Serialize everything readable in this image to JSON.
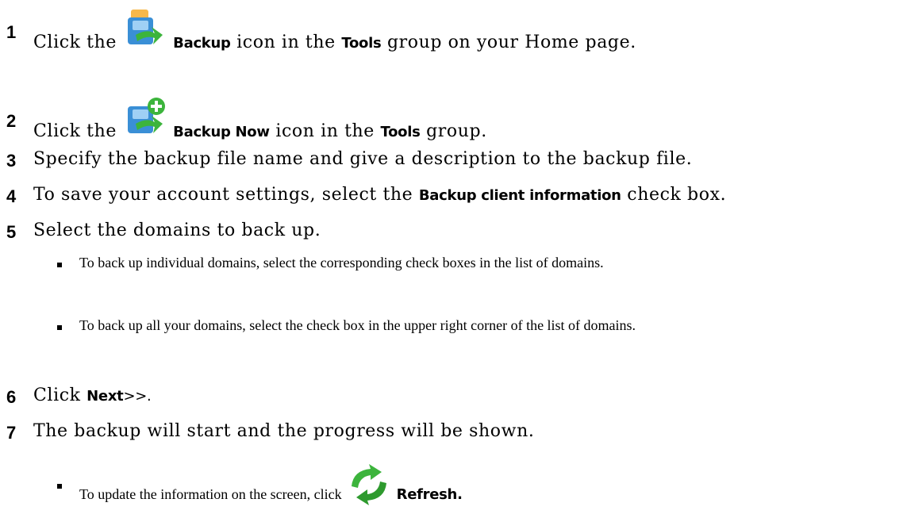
{
  "steps": [
    {
      "num": "1",
      "pre": "Click the",
      "ui1": "Backup",
      "mid": "icon in the",
      "ui2": "Tools",
      "post": "group on your Home page.",
      "icon": "backup-icon"
    },
    {
      "num": "2",
      "pre": "Click the",
      "ui1": "Backup Now",
      "mid": "icon in the",
      "ui2": "Tools",
      "post": "group.",
      "icon": "backup-now-icon"
    },
    {
      "num": "3",
      "text": "Specify the backup file name and give a description to the backup file."
    },
    {
      "num": "4",
      "pre": "To save your account settings, select the",
      "ui1": "Backup client information",
      "post": "check box."
    },
    {
      "num": "5",
      "text": "Select the domains to back up."
    },
    {
      "num": "6",
      "pre": "Click",
      "ui1": "Next",
      "post": ">>."
    },
    {
      "num": "7",
      "text": "The backup will start and the progress will be shown."
    }
  ],
  "bullets_step5": [
    {
      "text": "To back up individual domains, select the corresponding check boxes in the list of domains."
    },
    {
      "text": "To back up all your domains, select the check box in the upper right corner of the list of domains."
    }
  ],
  "bullet_step7": {
    "pre": "To update the information on the screen, click",
    "ui": "Refresh",
    "post": ".",
    "icon": "refresh-icon"
  },
  "colors": {
    "icon_blue": "#3a8fd6",
    "icon_orange": "#f5a623",
    "icon_green": "#3cb43c"
  }
}
